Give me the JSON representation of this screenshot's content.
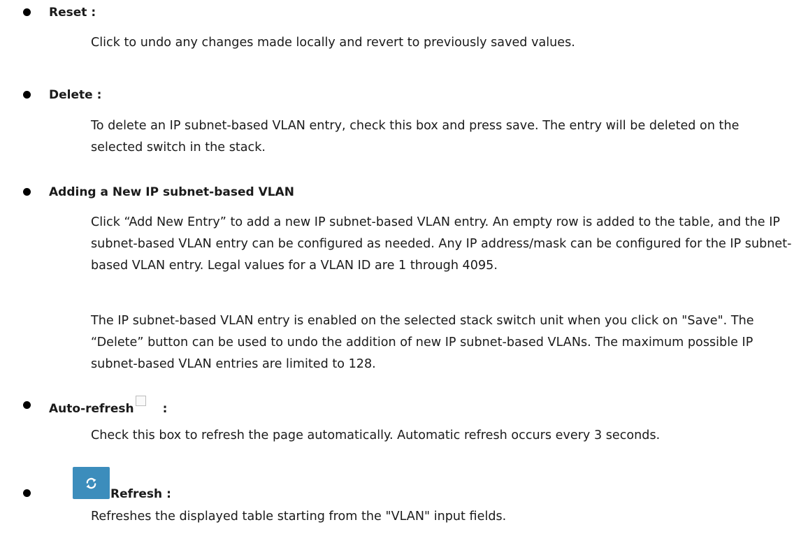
{
  "items": [
    {
      "title": "Reset :",
      "paragraphs": [
        "Click to undo any changes made locally and revert to previously saved values."
      ]
    },
    {
      "title": "Delete :",
      "paragraphs": [
        "To delete an IP subnet-based VLAN entry, check this box and press save. The entry will be deleted on the selected switch in the stack."
      ]
    },
    {
      "title": "Adding a New IP subnet-based VLAN",
      "paragraphs": [
        "Click “Add New Entry” to add a new IP subnet-based VLAN entry. An empty row is added to the table, and the IP subnet-based VLAN entry can be configured as needed. Any IP address/mask can be configured for the IP subnet-based VLAN entry. Legal values for a VLAN ID are 1 through 4095.",
        "The IP subnet-based VLAN entry is enabled on the selected stack switch unit when you click on \"Save\". The “Delete” button can be used to undo the addition of new IP subnet-based VLANs. The maximum possible IP subnet-based VLAN entries are limited to 128."
      ]
    },
    {
      "title": "Auto-refresh",
      "suffix": ":",
      "paragraphs": [
        "Check this box to refresh the page automatically. Automatic refresh occurs every 3 seconds."
      ]
    },
    {
      "title": "Refresh :",
      "paragraphs": [
        "Refreshes the displayed table starting from the \"VLAN\" input fields."
      ]
    }
  ],
  "icons": {
    "bullet": "bullet-dot",
    "auto_refresh_checkbox": "checkbox-unchecked",
    "refresh_button_icon": "refresh-arrows-icon"
  },
  "colors": {
    "refresh_button": "#3c8dbc",
    "text": "#1a1a1a"
  }
}
